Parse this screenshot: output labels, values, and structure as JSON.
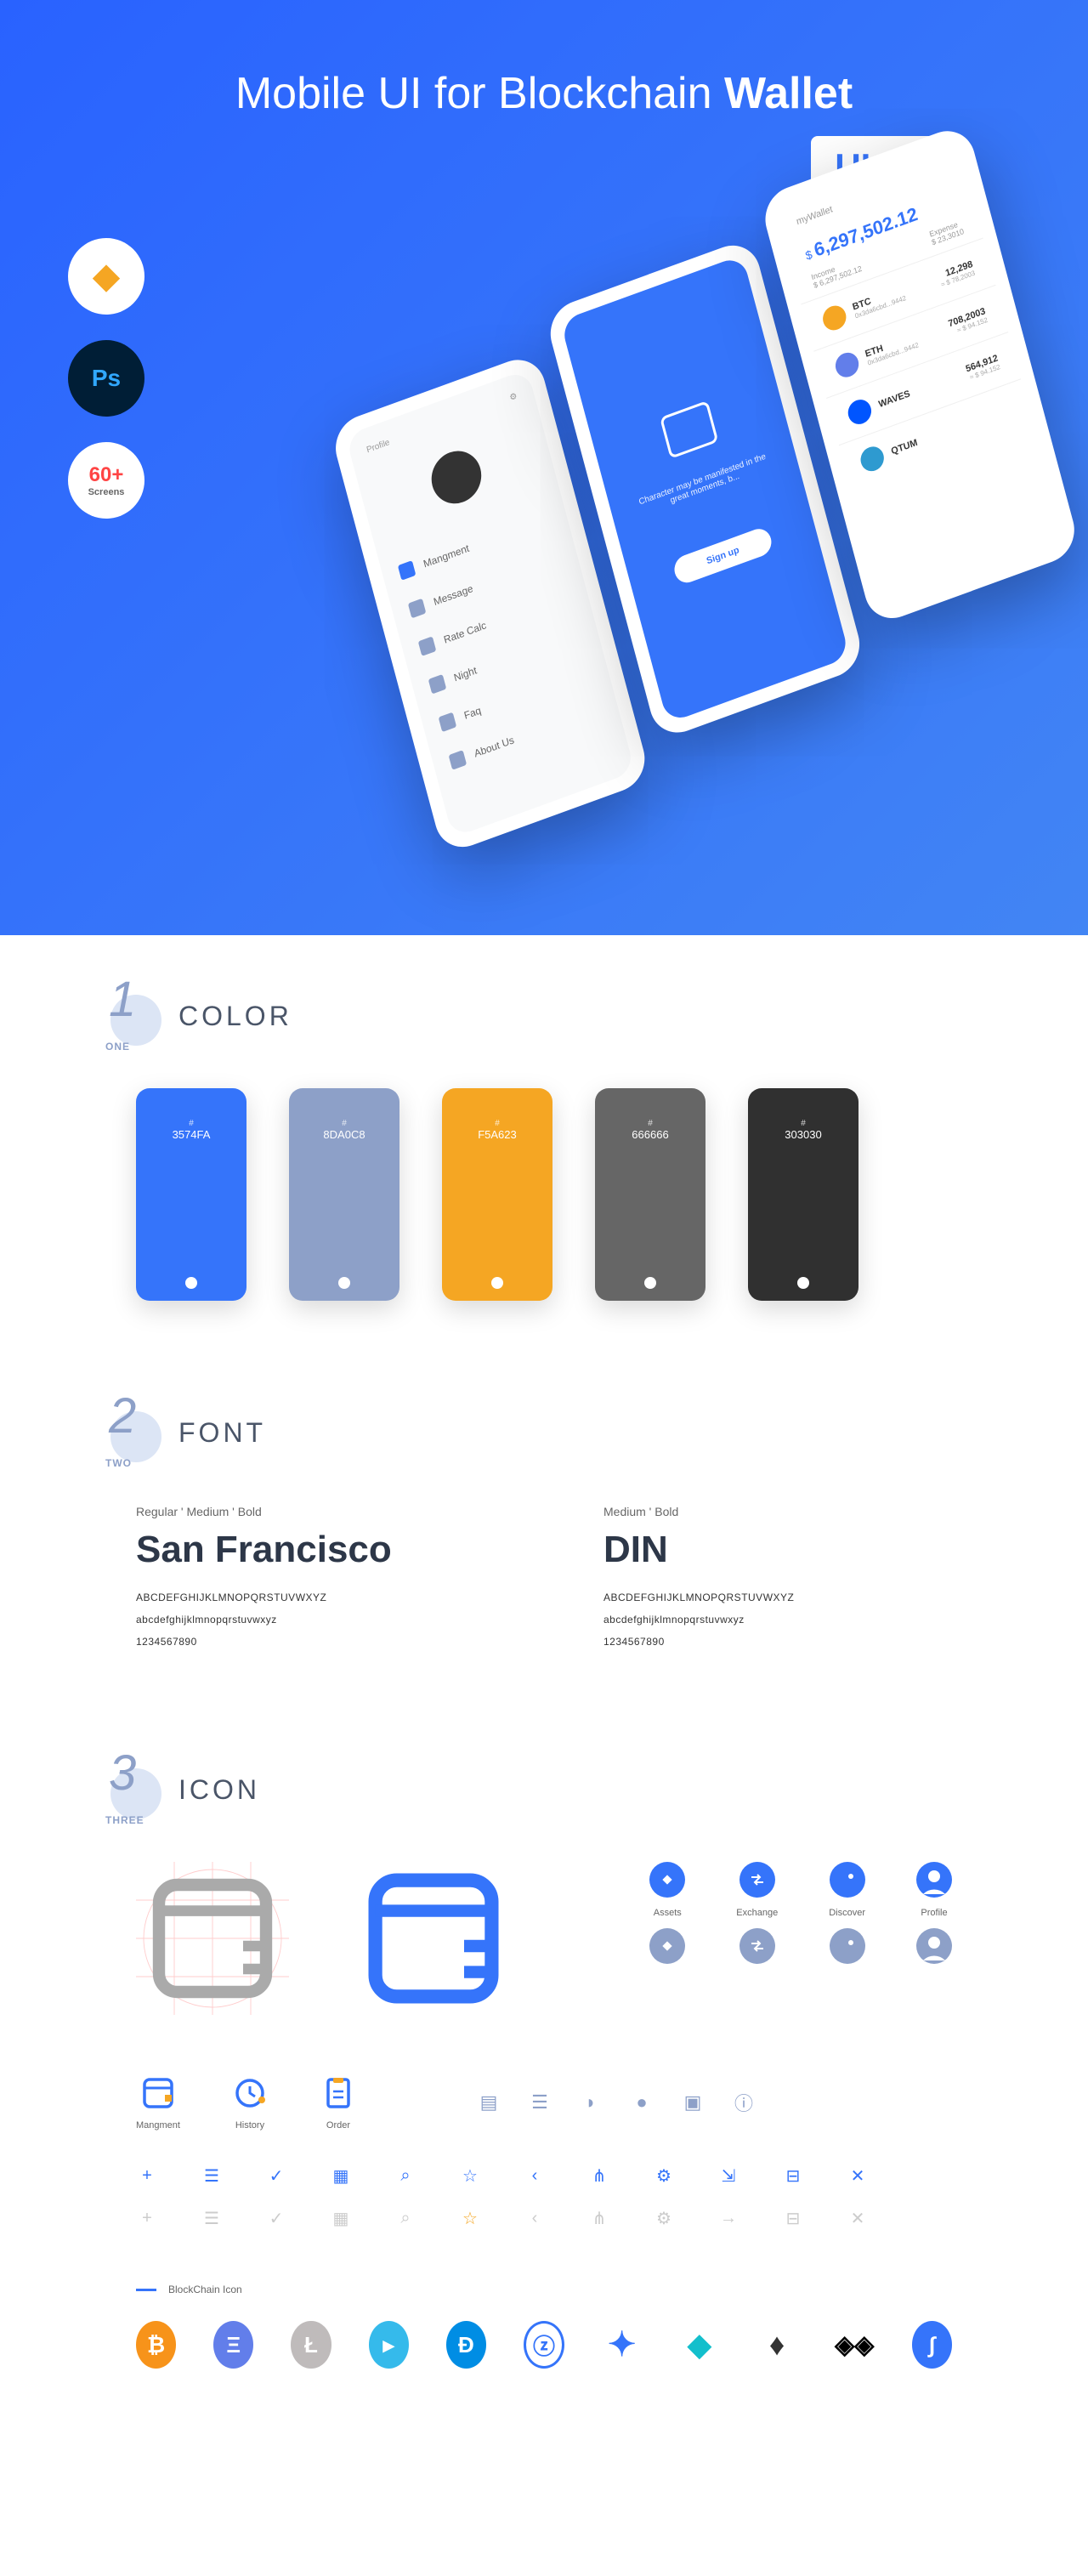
{
  "hero": {
    "title_pre": "Mobile UI for Blockchain ",
    "title_bold": "Wallet",
    "uikit": "UI Kit",
    "screens_num": "60+",
    "screens_lbl": "Screens"
  },
  "mock": {
    "profile_title": "Profile",
    "p1_items": [
      "Mangment",
      "Message",
      "Rate Calc",
      "Night",
      "Faq",
      "About Us"
    ],
    "p2_quote": "Character may be manifested in the great moments, b...",
    "p2_signup": "Sign up",
    "p3_wallet": "myWallet",
    "p3_balance": "6,297,502.12",
    "p3_income_lbl": "Income",
    "p3_income": "$ 6,297,502.12",
    "p3_expense_lbl": "Expense",
    "p3_expense": "$ 23,3010",
    "coins": [
      {
        "name": "BTC",
        "sub": "0x3da6cbd...9442",
        "amt": "12,298",
        "usd": "≈ $ 78,2003",
        "color": "#f5a623"
      },
      {
        "name": "ETH",
        "sub": "0x3da6cbd...9442",
        "amt": "708,2003",
        "usd": "≈ $ 94.152",
        "color": "#627eea"
      },
      {
        "name": "WAVES",
        "sub": "",
        "amt": "564,912",
        "usd": "≈ $ 94.152",
        "color": "#0055ff"
      },
      {
        "name": "QTUM",
        "sub": "",
        "amt": "",
        "usd": "",
        "color": "#2e9ad0"
      }
    ]
  },
  "sections": {
    "one_digit": "1",
    "one_word": "ONE",
    "one_title": "COLOR",
    "two_digit": "2",
    "two_word": "TWO",
    "two_title": "FONT",
    "three_digit": "3",
    "three_word": "THREE",
    "three_title": "ICON"
  },
  "colors": [
    {
      "hex": "3574FA"
    },
    {
      "hex": "8DA0C8"
    },
    {
      "hex": "F5A623"
    },
    {
      "hex": "666666"
    },
    {
      "hex": "303030"
    }
  ],
  "fonts": {
    "sf_weights": "Regular ' Medium ' Bold",
    "sf_name": "San Francisco",
    "din_weights": "Medium ' Bold",
    "din_name": "DIN",
    "upper": "ABCDEFGHIJKLMNOPQRSTUVWXYZ",
    "lower": "abcdefghijklmnopqrstuvwxyz",
    "nums": "1234567890"
  },
  "nav_icons": [
    "Assets",
    "Exchange",
    "Discover",
    "Profile"
  ],
  "labeled_icons": [
    "Mangment",
    "History",
    "Order"
  ],
  "bc_label": "BlockChain Icon",
  "hash": "#"
}
